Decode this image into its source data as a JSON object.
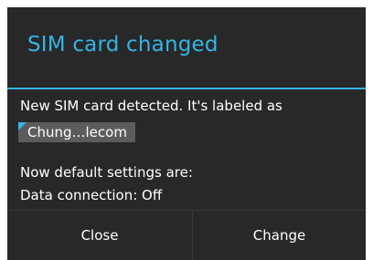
{
  "dialog": {
    "title": "SIM card changed",
    "message_line1": "New SIM card detected. It's labeled as",
    "sim_label": "Chung…lecom",
    "message_line2": "Now default settings are:",
    "message_line3": "Data connection:  Off",
    "buttons": {
      "close_label": "Close",
      "change_label": "Change"
    }
  },
  "colors": {
    "accent": "#33b5e5",
    "dialog_bg": "#282828",
    "chip_bg": "#5c5c5c"
  }
}
